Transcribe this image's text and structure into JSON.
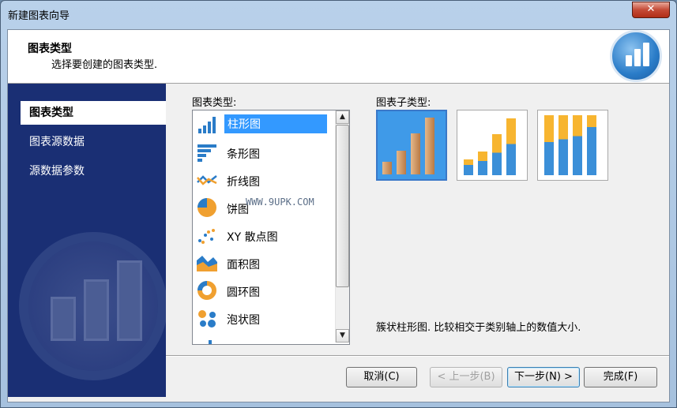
{
  "window": {
    "title": "新建图表向导",
    "close_label": "✕"
  },
  "header": {
    "title": "图表类型",
    "subtitle": "选择要创建的图表类型."
  },
  "sidebar": {
    "items": [
      {
        "label": "图表类型",
        "selected": true
      },
      {
        "label": "图表源数据",
        "selected": false
      },
      {
        "label": "源数据参数",
        "selected": false
      }
    ]
  },
  "main": {
    "type_label": "图表类型:",
    "subtype_label": "图表子类型:",
    "chart_types": [
      {
        "label": "柱形图",
        "icon": "column-chart-icon",
        "selected": true
      },
      {
        "label": "条形图",
        "icon": "bar-chart-icon",
        "selected": false
      },
      {
        "label": "折线图",
        "icon": "line-chart-icon",
        "selected": false
      },
      {
        "label": "饼图",
        "icon": "pie-chart-icon",
        "selected": false
      },
      {
        "label": "XY 散点图",
        "icon": "scatter-chart-icon",
        "selected": false
      },
      {
        "label": "面积图",
        "icon": "area-chart-icon",
        "selected": false
      },
      {
        "label": "圆环图",
        "icon": "doughnut-chart-icon",
        "selected": false
      },
      {
        "label": "泡状图",
        "icon": "bubble-chart-icon",
        "selected": false
      }
    ],
    "watermark": "WWW.9UPK.COM",
    "description": "簇状柱形图. 比较相交于类别轴上的数值大小."
  },
  "colors": {
    "sidebar_bg": "#1a2f74",
    "selection": "#3399ff",
    "bar_orange": "#f0a030",
    "bar_blue": "#2a7cc8"
  },
  "buttons": {
    "cancel": "取消(C)",
    "back": "< 上一步(B)",
    "next": "下一步(N) >",
    "finish": "完成(F)"
  }
}
